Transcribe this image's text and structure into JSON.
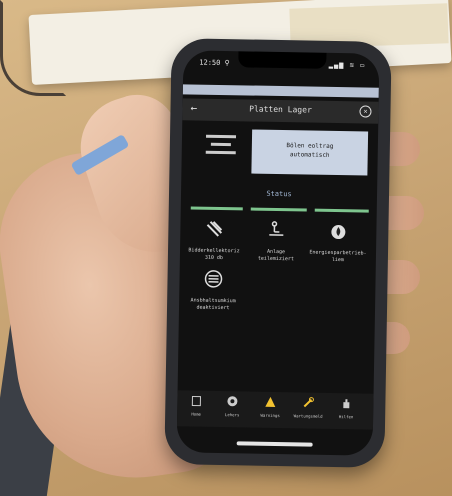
{
  "scene": {
    "description_colors": {
      "table": "#c9a676",
      "phone_body": "#2c2d31",
      "screen_bg": "#111111",
      "accent_green": "#7ec58e",
      "info_box": "#c9d3e3"
    }
  },
  "phone": {
    "status": {
      "time": "12:50 ⚲",
      "icons": "▂▄▆ ≋ ▭"
    },
    "header": {
      "back_icon": "arrow-left-icon",
      "title": "Platten Lager",
      "close_icon": "close-icon"
    },
    "info": {
      "line1": "Bölen eoltrag",
      "line2": "automatisch"
    },
    "section_title": "Status",
    "tiles": [
      {
        "icon": "diagonal-bars-icon",
        "line1": "Bidderkellektoriz",
        "line2": "310 db"
      },
      {
        "icon": "conveyor-icon",
        "line1": "Anlage",
        "line2": "teilemiziert"
      },
      {
        "icon": "flame-icon",
        "line1": "Energiesparbetrieb-",
        "line2": "liem"
      },
      {
        "icon": "no-entry-icon",
        "line1": "Ansbhaltsumkium",
        "line2": "deaktiviert"
      }
    ],
    "nav": [
      {
        "label": "Home",
        "icon": "home-icon"
      },
      {
        "label": "Lehers",
        "icon": "gear-icon"
      },
      {
        "label": "Warnings",
        "icon": "warning-icon"
      },
      {
        "label": "Wartungsmeld",
        "icon": "wrench-icon"
      },
      {
        "label": "Hilfen",
        "icon": "hand-icon"
      }
    ]
  }
}
